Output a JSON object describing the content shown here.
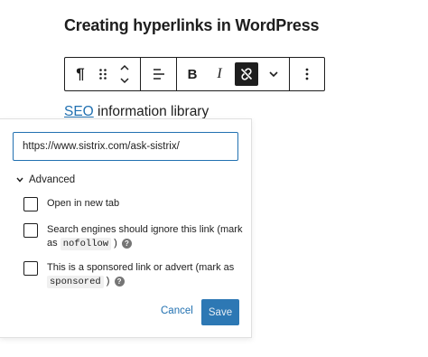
{
  "page": {
    "title": "Creating hyperlinks in WordPress"
  },
  "toolbar": {
    "paragraph_icon": "paragraph-icon",
    "drag_icon": "drag-handle-icon",
    "move_icon": "move-up-down-icon",
    "align_icon": "align-left-icon",
    "bold_label": "B",
    "italic_label": "I",
    "unlink_icon": "unlink-icon",
    "more_formats_icon": "chevron-down-icon",
    "options_icon": "more-vertical-icon"
  },
  "content": {
    "link_text": "SEO",
    "rest_text": " information library"
  },
  "link_popover": {
    "url_value": "https://www.sistrix.com/ask-sistrix/",
    "advanced_label": "Advanced",
    "options": [
      {
        "text": "Open in new tab"
      },
      {
        "text_before": "Search engines should ignore this link (mark as ",
        "code": "nofollow",
        "text_after": " )"
      },
      {
        "text_before": "This is a sponsored link or advert (mark as ",
        "code": "sponsored",
        "text_after": " )"
      }
    ],
    "cancel_label": "Cancel",
    "save_label": "Save"
  },
  "colors": {
    "accent": "#2271b1",
    "text": "#1e1e1e"
  }
}
